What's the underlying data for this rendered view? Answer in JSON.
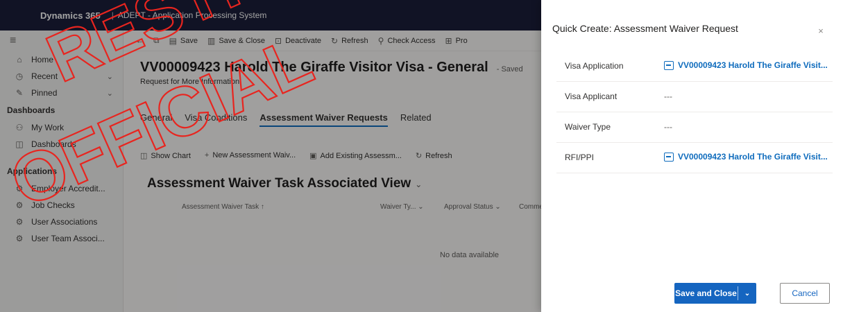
{
  "topbar": {
    "brand": "Dynamics 365",
    "app_name": "ADEPT - Application Processing System"
  },
  "sidebar": {
    "items_top": [
      {
        "label": "Home",
        "icon": "home-icon"
      },
      {
        "label": "Recent",
        "icon": "clock-icon",
        "chevron": "⌄"
      },
      {
        "label": "Pinned",
        "icon": "pin-icon",
        "chevron": "⌄"
      }
    ],
    "dashboards_header": "Dashboards",
    "dashboards": [
      {
        "label": "My Work",
        "icon": "people-icon"
      },
      {
        "label": "Dashboards",
        "icon": "dashboard-icon"
      }
    ],
    "applications_header": "Applications",
    "applications": [
      {
        "label": "Employer Accredit...",
        "icon": "entity-icon"
      },
      {
        "label": "Job Checks",
        "icon": "entity-icon"
      },
      {
        "label": "User Associations",
        "icon": "entity-icon"
      },
      {
        "label": "User Team Associ...",
        "icon": "entity-icon"
      }
    ]
  },
  "commandbar": {
    "back": "←",
    "items": [
      "Save",
      "Save & Close",
      "Deactivate",
      "Refresh",
      "Check Access",
      "Pro"
    ]
  },
  "record": {
    "title": "VV00009423 Harold The Giraffe Visitor Visa - General",
    "saved": "- Saved",
    "subtitle": "Request for More Information"
  },
  "tabs": [
    {
      "label": "General",
      "active": false
    },
    {
      "label": "Visa Conditions",
      "active": false
    },
    {
      "label": "Assessment Waiver Requests",
      "active": true
    },
    {
      "label": "Related",
      "active": false
    }
  ],
  "subgrid": {
    "commands": [
      "Show Chart",
      "New Assessment Waiv...",
      "Add Existing Assessm...",
      "Refresh"
    ],
    "view_title": "Assessment Waiver Task Associated View",
    "columns": [
      "Assessment Waiver Task ↑",
      "Waiver Ty... ⌄",
      "Approval Status ⌄",
      "Comme"
    ],
    "empty_text": "No data available"
  },
  "quick_create": {
    "title": "Quick Create: Assessment Waiver Request",
    "close": "×",
    "fields": [
      {
        "label": "Visa Application",
        "value": "VV00009423 Harold The Giraffe Visit...",
        "type": "lookup"
      },
      {
        "label": "Visa Applicant",
        "value": "---",
        "type": "text"
      },
      {
        "label": "Waiver Type",
        "value": "---",
        "type": "text"
      },
      {
        "label": "RFI/PPI",
        "value": "VV00009423 Harold The Giraffe Visit...",
        "type": "lookup"
      }
    ],
    "save_label": "Save and Close",
    "save_arrow": "⌄",
    "cancel_label": "Cancel"
  },
  "watermark": {
    "line1": "RESTRICTED",
    "line2": "OFFICIAL",
    "color": "#e8251f"
  },
  "colors": {
    "accent": "#1565c0",
    "link": "#0f6cbd",
    "topbar": "#1b1f3a"
  }
}
